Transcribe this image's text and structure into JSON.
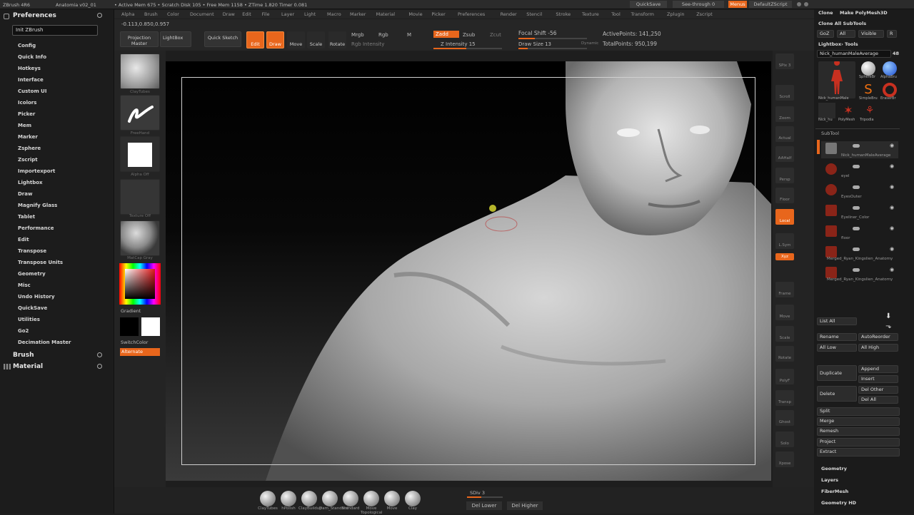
{
  "titlebar": {
    "app": "ZBrush 4R6",
    "doc": "Anatomia v02_01",
    "stats": "• Active Mem 675 • Scratch Disk 105 • Free Mem 1158 • ZTime 1.820 Timer 0.081",
    "quicksave": "QuickSave",
    "seethrough": "See-through 0",
    "menus": "Menus",
    "script": "DefaultZScript"
  },
  "menubar": [
    "Alpha",
    "Brush",
    "Color",
    "Document",
    "Draw",
    "Edit",
    "File",
    "Layer",
    "Light",
    "Macro",
    "Marker",
    "Material",
    "Movie",
    "Picker",
    "Preferences",
    "Render",
    "Stencil",
    "Stroke",
    "Texture",
    "Tool",
    "Transform",
    "Zplugin",
    "Zscript"
  ],
  "left": {
    "preferences": "Preferences",
    "init": "Init ZBrush",
    "items": [
      "Config",
      "Quick Info",
      "Hotkeys",
      "Interface",
      "Custom UI",
      "Icolors",
      "Picker",
      "Mem",
      "Marker",
      "Zsphere",
      "Zscript",
      "Importexport",
      "Lightbox",
      "Draw",
      "Magnify Glass",
      "Tablet",
      "Performance",
      "Edit",
      "Transpose",
      "Transpose Units",
      "Geometry",
      "Misc",
      "Undo History",
      "QuickSave",
      "Utilities",
      "Go2",
      "Decimation Master"
    ],
    "brush": "Brush",
    "material": "Material"
  },
  "shelf": {
    "coords": "-0.113,0.850,0.957",
    "projection": "Projection Master",
    "lightbox": "LightBox",
    "quicksketch": "Quick Sketch",
    "edit": "Edit",
    "draw": "Draw",
    "move": "Move",
    "scale": "Scale",
    "rotate": "Rotate",
    "mrgb": "Mrgb",
    "rgb": "Rgb",
    "m": "M",
    "zadd": "Zadd",
    "zsub": "Zsub",
    "zcut": "Zcut",
    "rgb_intensity": "Rgb Intensity",
    "z_intensity": "Z Intensity 15",
    "focal_shift": "Focal Shift -56",
    "draw_size": "Draw Size 13",
    "dynamic": "Dynamic",
    "active_points": "ActivePoints: 141,250",
    "total_points": "TotalPoints: 950,199"
  },
  "lefttray": {
    "brush_label": "ClayTubes",
    "stroke_label": "FreeHand",
    "alpha_label": "Alpha Off",
    "texture_label": "Texture Off",
    "material_label": "MatCap Gray",
    "gradient": "Gradient",
    "switchcolor": "SwitchColor",
    "alternate": "Alternate"
  },
  "righttray": [
    "SPix 3",
    "Scroll",
    "Zoom",
    "Actual",
    "AAHalf",
    "Persp",
    "Floor",
    "Local",
    "L.Sym",
    "Xyz",
    "Frame",
    "Move",
    "Scale",
    "Rotate",
    "PolyF",
    "Transp",
    "Ghost",
    "Solo",
    "Xpose"
  ],
  "rightpanel": {
    "clone": "Clone",
    "make_polymesh": "Make PolyMesh3D",
    "clone_all": "Clone All SubTools",
    "goz": "GoZ",
    "all": "All",
    "visible": "Visible",
    "r": "R",
    "lightbox_tools": "Lightbox› Tools",
    "current_tool": "Nick_humanMaleAverage",
    "tool_count": "48",
    "tool_names": [
      "Nick_humanMale",
      "SphereBr",
      "AlphaBru",
      "SimpleBru",
      "EraserBr",
      "Nick_hu",
      "PolyMesh",
      "Tripodla"
    ],
    "subtool": "SubTool",
    "subtools": [
      "Nick_humanMaleAverage",
      "eyel",
      "EyesOuter",
      "Eyeliner_Color",
      "floor",
      "Merged_Ryan_Kingslien_Anatomy",
      "Merged_Ryan_Kingslien_Anatomy"
    ],
    "list_all": "List All",
    "rename": "Rename",
    "autoreorder": "AutoReorder",
    "all_low": "All Low",
    "all_high": "All High",
    "duplicate": "Duplicate",
    "append": "Append",
    "insert": "Insert",
    "delete": "Delete",
    "del_other": "Del Other",
    "del_all": "Del All",
    "split": "Split",
    "merge": "Merge",
    "remesh": "Remesh",
    "project": "Project",
    "extract": "Extract",
    "geometry": "Geometry",
    "layers": "Layers",
    "fibermesh": "FiberMesh",
    "geometry_hd": "Geometry HD"
  },
  "bottom": {
    "brushes": [
      "ClayTubes",
      "hPolish",
      "ClayBuildup",
      "Dam_Standard",
      "Standard",
      "Move Topological",
      "Move",
      "Clay"
    ],
    "sdiv": "SDiv 3",
    "del_lower": "Del Lower",
    "del_higher": "Del Higher"
  }
}
